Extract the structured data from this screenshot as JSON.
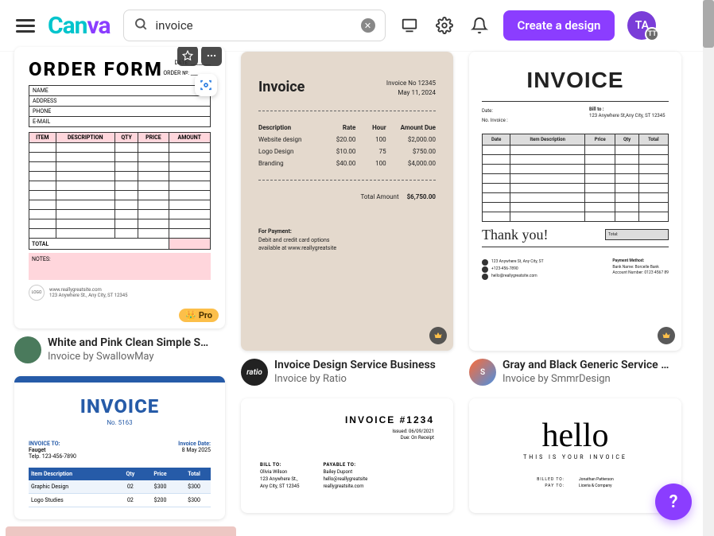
{
  "header": {
    "logo": "Canva",
    "search_value": "invoice",
    "create_label": "Create a design",
    "avatar_initials": "TA",
    "avatar_sub": "TT"
  },
  "cards": {
    "c1": {
      "title": "White and Pink Clean Simple S…",
      "subtitle": "Invoice by SwallowMay",
      "pro_label": "Pro",
      "t": {
        "heading": "ORDER FORM",
        "date_label": "DATE:",
        "orderno_label": "ORDER №:",
        "f_name": "NAME",
        "f_address": "ADDRESS",
        "f_phone": "PHONE",
        "f_email": "E-MAIL",
        "th_item": "ITEM",
        "th_desc": "DESCRIPTION",
        "th_qty": "QTY",
        "th_price": "PRICE",
        "th_amount": "AMOUNT",
        "total": "TOTAL",
        "notes": "NOTES:",
        "logo": "LOGO",
        "site": "www.reallygreatsite.com",
        "addr": "123 Anywhere St., Any City, ST 12345"
      }
    },
    "c2": {
      "title": "Invoice Design Service Business",
      "subtitle": "Invoice by Ratio",
      "t": {
        "heading": "Invoice",
        "inv_no": "Invoice No 12345",
        "inv_date": "May 11, 2024",
        "th_desc": "Description",
        "th_rate": "Rate",
        "th_hour": "Hour",
        "th_amt": "Amount Due",
        "r1_d": "Website design",
        "r1_r": "$20.00",
        "r1_h": "100",
        "r1_a": "$2,000.00",
        "r2_d": "Logo Design",
        "r2_r": "$10.00",
        "r2_h": "75",
        "r2_a": "$750.00",
        "r3_d": "Branding",
        "r3_r": "$40.00",
        "r3_h": "100",
        "r3_a": "$4,000.00",
        "total_label": "Total Amount",
        "total_val": "$6,750.00",
        "pay_h": "For Payment:",
        "pay_1": "Debit and credit card options",
        "pay_2": "available at www.reallygreatsite"
      }
    },
    "c3": {
      "title": "Gray and Black Generic Service …",
      "subtitle": "Invoice by SmmrDesign",
      "t": {
        "heading": "INVOICE",
        "date": "Date:",
        "noinv": "No. Invoice :",
        "bill": "Bill to :",
        "addr": "123 Anywhere St,Any City, ST 12345",
        "th_date": "Date",
        "th_desc": "Item Description",
        "th_price": "Price",
        "th_qty": "Qty",
        "th_total": "Total",
        "thanks": "Thank you!",
        "tbox": "Total:",
        "b_addr": "123 Anywhere St, Any City, ST",
        "b_phone": "+123-456-7890",
        "b_mail": "hello@reallygreatsite.com",
        "pm": "Payment Method:",
        "bank": "Bank Name: Borcelle Bank",
        "acct": "Account Number: 0123 4567 89"
      }
    },
    "c4": {
      "t": {
        "heading": "INVOICE",
        "no": "No. 5163",
        "to_l": "INVOICE TO:",
        "to_v": "Fauget",
        "to_p": "Telp. 123-456-7890",
        "dt_l": "Invoice Date:",
        "dt_v": "8 May 2025",
        "th_desc": "Item Description",
        "th_qty": "Qty",
        "th_price": "Price",
        "th_total": "Total",
        "r1_d": "Graphic Design",
        "r1_q": "02",
        "r1_p": "$300",
        "r1_t": "$300",
        "r2_d": "Logo Studies",
        "r2_q": "02",
        "r2_p": "$200",
        "r2_t": "$300"
      }
    },
    "c5": {
      "t": {
        "heading": "INVOICE #1234",
        "issued": "Issued: 06/09/2021",
        "due": "Due: On Receipt",
        "billto": "BILL TO:",
        "b1": "Olivia Wilson",
        "b2": "123 Anywhere St.,",
        "b3": "Any City, ST 12345",
        "payto": "PAYABLE TO:",
        "p1": "Bailey Dupont",
        "p2": "hello@reallygreatsite",
        "p3": "reallygreatsite.com"
      }
    },
    "c6": {
      "t": {
        "script": "hello",
        "sub": "THIS IS YOUR INVOICE",
        "billed": "BILLED TO:",
        "payto": "PAY TO:",
        "name": "Jonathan Patterson",
        "co": "Liceria & Company"
      }
    }
  },
  "help": "?"
}
